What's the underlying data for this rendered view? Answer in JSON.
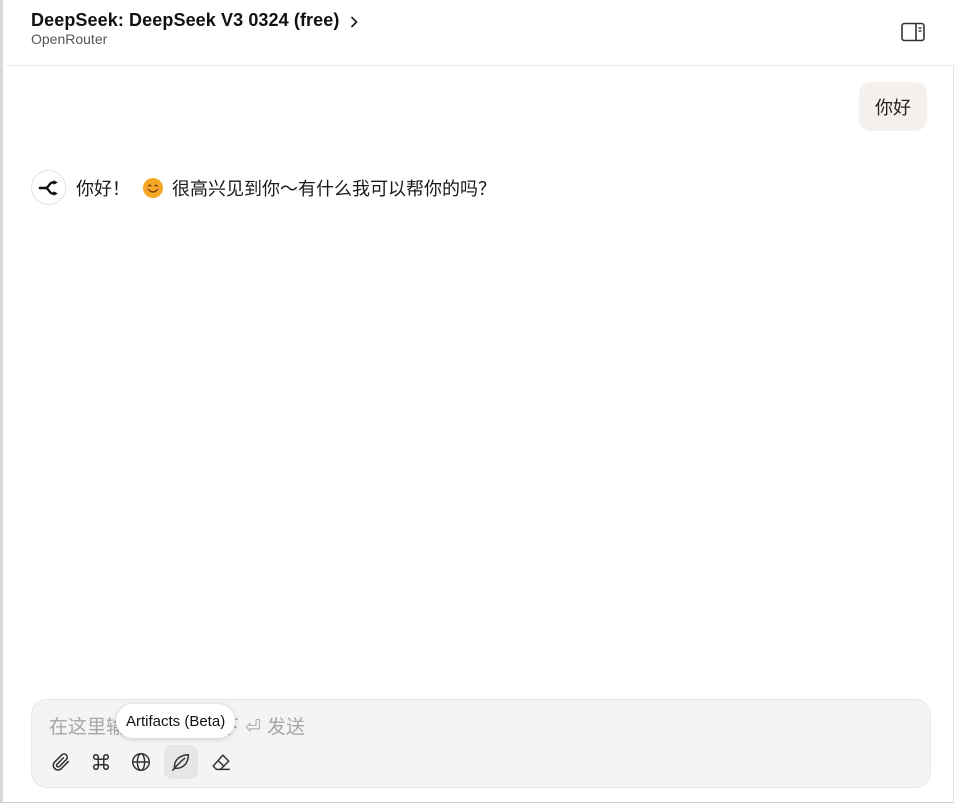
{
  "header": {
    "title": "DeepSeek: DeepSeek V3 0324 (free)",
    "provider": "OpenRouter",
    "panel_toggle_icon": "sidebar-panel-icon"
  },
  "messages": {
    "user": "你好",
    "assistant": {
      "greeting": "你好！",
      "emoji": "smiling-face-emoji",
      "rest": "很高兴见到你～有什么我可以帮你的吗？"
    }
  },
  "composer": {
    "placeholder": "在这里输入消息，按下 ⏎ 发送",
    "tools": [
      {
        "name": "attach",
        "icon": "paperclip-icon"
      },
      {
        "name": "shortcuts",
        "icon": "command-icon"
      },
      {
        "name": "web-search",
        "icon": "globe-icon"
      },
      {
        "name": "artifacts",
        "icon": "leaf-icon"
      },
      {
        "name": "clear",
        "icon": "eraser-icon"
      }
    ]
  },
  "tooltip": {
    "text": "Artifacts (Beta)"
  },
  "colors": {
    "user_bubble": "#f4f0ed",
    "composer_bg": "#f4f4f4",
    "emoji": "#f5a623"
  }
}
